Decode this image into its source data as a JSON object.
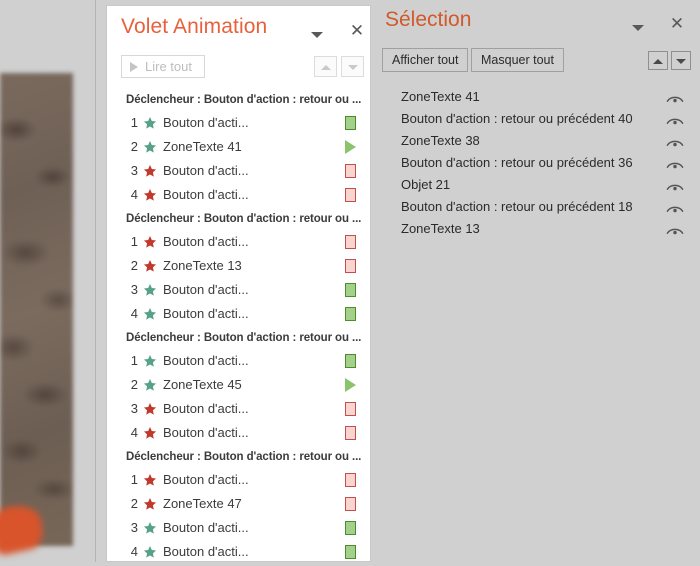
{
  "slide": {
    "thumbnail_name": "slide-thumbnail"
  },
  "animation_pane": {
    "title": "Volet Animation",
    "dropdown_icon": "chevron-down-icon",
    "close_icon": "close-icon",
    "play_all_label": "Lire tout",
    "play_icon": "play-icon",
    "move_up_icon": "arrow-up-icon",
    "move_down_icon": "arrow-down-icon",
    "groups": [
      {
        "trigger": "Déclencheur : Bouton d'action : retour ou ...",
        "rows": [
          {
            "index": "1",
            "label": "Bouton d'acti...",
            "star": "green",
            "bar": "rect-green"
          },
          {
            "index": "2",
            "label": "ZoneTexte 41",
            "star": "green",
            "bar": "tri-green"
          },
          {
            "index": "3",
            "label": "Bouton d'acti...",
            "star": "red",
            "bar": "rect-red"
          },
          {
            "index": "4",
            "label": "Bouton d'acti...",
            "star": "red",
            "bar": "rect-red"
          }
        ]
      },
      {
        "trigger": "Déclencheur : Bouton d'action : retour ou ...",
        "rows": [
          {
            "index": "1",
            "label": "Bouton d'acti...",
            "star": "red",
            "bar": "rect-red"
          },
          {
            "index": "2",
            "label": "ZoneTexte 13",
            "star": "red",
            "bar": "rect-red"
          },
          {
            "index": "3",
            "label": "Bouton d'acti...",
            "star": "green",
            "bar": "rect-green"
          },
          {
            "index": "4",
            "label": "Bouton d'acti...",
            "star": "green",
            "bar": "rect-green"
          }
        ]
      },
      {
        "trigger": "Déclencheur : Bouton d'action : retour ou ...",
        "rows": [
          {
            "index": "1",
            "label": "Bouton d'acti...",
            "star": "green",
            "bar": "rect-green"
          },
          {
            "index": "2",
            "label": "ZoneTexte 45",
            "star": "green",
            "bar": "tri-green"
          },
          {
            "index": "3",
            "label": "Bouton d'acti...",
            "star": "red",
            "bar": "rect-red"
          },
          {
            "index": "4",
            "label": "Bouton d'acti...",
            "star": "red",
            "bar": "rect-red"
          }
        ]
      },
      {
        "trigger": "Déclencheur : Bouton d'action : retour ou ...",
        "rows": [
          {
            "index": "1",
            "label": "Bouton d'acti...",
            "star": "red",
            "bar": "rect-red"
          },
          {
            "index": "2",
            "label": "ZoneTexte 47",
            "star": "red",
            "bar": "rect-red"
          },
          {
            "index": "3",
            "label": "Bouton d'acti...",
            "star": "green",
            "bar": "rect-green"
          },
          {
            "index": "4",
            "label": "Bouton d'acti...",
            "star": "green",
            "bar": "rect-green"
          }
        ]
      }
    ]
  },
  "selection_pane": {
    "title": "Sélection",
    "dropdown_icon": "chevron-down-icon",
    "close_icon": "close-icon",
    "show_all_label": "Afficher tout",
    "hide_all_label": "Masquer tout",
    "move_up_icon": "arrow-up-icon",
    "move_down_icon": "arrow-down-icon",
    "items": [
      {
        "label": "ZoneTexte 41",
        "visibility_icon": "eye-icon"
      },
      {
        "label": "Bouton d'action : retour ou précédent 40",
        "visibility_icon": "eye-icon"
      },
      {
        "label": "ZoneTexte 38",
        "visibility_icon": "eye-icon"
      },
      {
        "label": "Bouton d'action : retour ou précédent 36",
        "visibility_icon": "eye-icon"
      },
      {
        "label": "Objet 21",
        "visibility_icon": "eye-icon"
      },
      {
        "label": "Bouton d'action : retour ou précédent 18",
        "visibility_icon": "eye-icon"
      },
      {
        "label": "ZoneTexte 13",
        "visibility_icon": "eye-icon"
      }
    ]
  },
  "colors": {
    "title_orange": "#e8613c",
    "selection_title_orange": "#d05a2b",
    "star_green": "#57a08a",
    "star_red": "#c0392b",
    "bar_green_fill": "#a3d18a",
    "bar_green_border": "#4d8b2e",
    "bar_red_fill": "#fad4cf",
    "bar_red_border": "#c0504d",
    "pane_background": "#d0d0d0",
    "panel_white": "#ffffff"
  }
}
